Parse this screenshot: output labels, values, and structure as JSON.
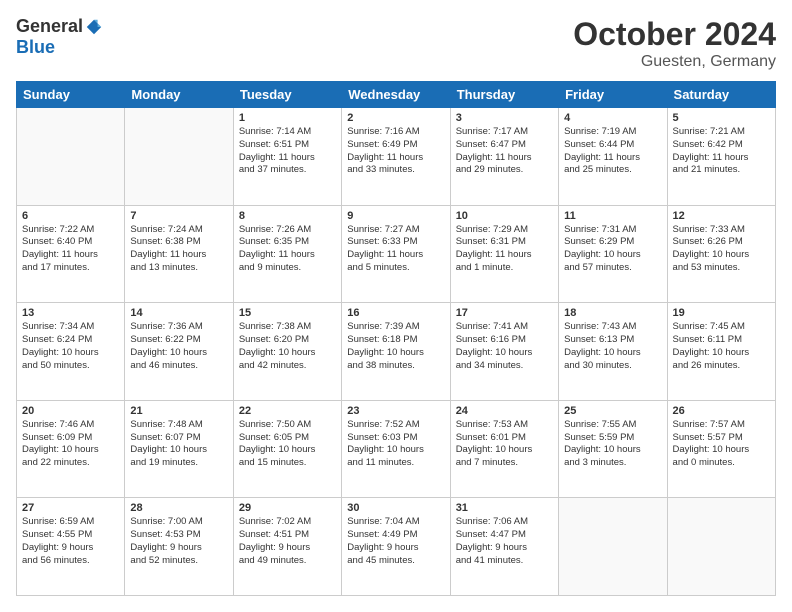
{
  "header": {
    "logo_general": "General",
    "logo_blue": "Blue",
    "title": "October 2024",
    "location": "Guesten, Germany"
  },
  "weekdays": [
    "Sunday",
    "Monday",
    "Tuesday",
    "Wednesday",
    "Thursday",
    "Friday",
    "Saturday"
  ],
  "weeks": [
    [
      {
        "day": "",
        "info": ""
      },
      {
        "day": "",
        "info": ""
      },
      {
        "day": "1",
        "info": "Sunrise: 7:14 AM\nSunset: 6:51 PM\nDaylight: 11 hours\nand 37 minutes."
      },
      {
        "day": "2",
        "info": "Sunrise: 7:16 AM\nSunset: 6:49 PM\nDaylight: 11 hours\nand 33 minutes."
      },
      {
        "day": "3",
        "info": "Sunrise: 7:17 AM\nSunset: 6:47 PM\nDaylight: 11 hours\nand 29 minutes."
      },
      {
        "day": "4",
        "info": "Sunrise: 7:19 AM\nSunset: 6:44 PM\nDaylight: 11 hours\nand 25 minutes."
      },
      {
        "day": "5",
        "info": "Sunrise: 7:21 AM\nSunset: 6:42 PM\nDaylight: 11 hours\nand 21 minutes."
      }
    ],
    [
      {
        "day": "6",
        "info": "Sunrise: 7:22 AM\nSunset: 6:40 PM\nDaylight: 11 hours\nand 17 minutes."
      },
      {
        "day": "7",
        "info": "Sunrise: 7:24 AM\nSunset: 6:38 PM\nDaylight: 11 hours\nand 13 minutes."
      },
      {
        "day": "8",
        "info": "Sunrise: 7:26 AM\nSunset: 6:35 PM\nDaylight: 11 hours\nand 9 minutes."
      },
      {
        "day": "9",
        "info": "Sunrise: 7:27 AM\nSunset: 6:33 PM\nDaylight: 11 hours\nand 5 minutes."
      },
      {
        "day": "10",
        "info": "Sunrise: 7:29 AM\nSunset: 6:31 PM\nDaylight: 11 hours\nand 1 minute."
      },
      {
        "day": "11",
        "info": "Sunrise: 7:31 AM\nSunset: 6:29 PM\nDaylight: 10 hours\nand 57 minutes."
      },
      {
        "day": "12",
        "info": "Sunrise: 7:33 AM\nSunset: 6:26 PM\nDaylight: 10 hours\nand 53 minutes."
      }
    ],
    [
      {
        "day": "13",
        "info": "Sunrise: 7:34 AM\nSunset: 6:24 PM\nDaylight: 10 hours\nand 50 minutes."
      },
      {
        "day": "14",
        "info": "Sunrise: 7:36 AM\nSunset: 6:22 PM\nDaylight: 10 hours\nand 46 minutes."
      },
      {
        "day": "15",
        "info": "Sunrise: 7:38 AM\nSunset: 6:20 PM\nDaylight: 10 hours\nand 42 minutes."
      },
      {
        "day": "16",
        "info": "Sunrise: 7:39 AM\nSunset: 6:18 PM\nDaylight: 10 hours\nand 38 minutes."
      },
      {
        "day": "17",
        "info": "Sunrise: 7:41 AM\nSunset: 6:16 PM\nDaylight: 10 hours\nand 34 minutes."
      },
      {
        "day": "18",
        "info": "Sunrise: 7:43 AM\nSunset: 6:13 PM\nDaylight: 10 hours\nand 30 minutes."
      },
      {
        "day": "19",
        "info": "Sunrise: 7:45 AM\nSunset: 6:11 PM\nDaylight: 10 hours\nand 26 minutes."
      }
    ],
    [
      {
        "day": "20",
        "info": "Sunrise: 7:46 AM\nSunset: 6:09 PM\nDaylight: 10 hours\nand 22 minutes."
      },
      {
        "day": "21",
        "info": "Sunrise: 7:48 AM\nSunset: 6:07 PM\nDaylight: 10 hours\nand 19 minutes."
      },
      {
        "day": "22",
        "info": "Sunrise: 7:50 AM\nSunset: 6:05 PM\nDaylight: 10 hours\nand 15 minutes."
      },
      {
        "day": "23",
        "info": "Sunrise: 7:52 AM\nSunset: 6:03 PM\nDaylight: 10 hours\nand 11 minutes."
      },
      {
        "day": "24",
        "info": "Sunrise: 7:53 AM\nSunset: 6:01 PM\nDaylight: 10 hours\nand 7 minutes."
      },
      {
        "day": "25",
        "info": "Sunrise: 7:55 AM\nSunset: 5:59 PM\nDaylight: 10 hours\nand 3 minutes."
      },
      {
        "day": "26",
        "info": "Sunrise: 7:57 AM\nSunset: 5:57 PM\nDaylight: 10 hours\nand 0 minutes."
      }
    ],
    [
      {
        "day": "27",
        "info": "Sunrise: 6:59 AM\nSunset: 4:55 PM\nDaylight: 9 hours\nand 56 minutes."
      },
      {
        "day": "28",
        "info": "Sunrise: 7:00 AM\nSunset: 4:53 PM\nDaylight: 9 hours\nand 52 minutes."
      },
      {
        "day": "29",
        "info": "Sunrise: 7:02 AM\nSunset: 4:51 PM\nDaylight: 9 hours\nand 49 minutes."
      },
      {
        "day": "30",
        "info": "Sunrise: 7:04 AM\nSunset: 4:49 PM\nDaylight: 9 hours\nand 45 minutes."
      },
      {
        "day": "31",
        "info": "Sunrise: 7:06 AM\nSunset: 4:47 PM\nDaylight: 9 hours\nand 41 minutes."
      },
      {
        "day": "",
        "info": ""
      },
      {
        "day": "",
        "info": ""
      }
    ]
  ]
}
